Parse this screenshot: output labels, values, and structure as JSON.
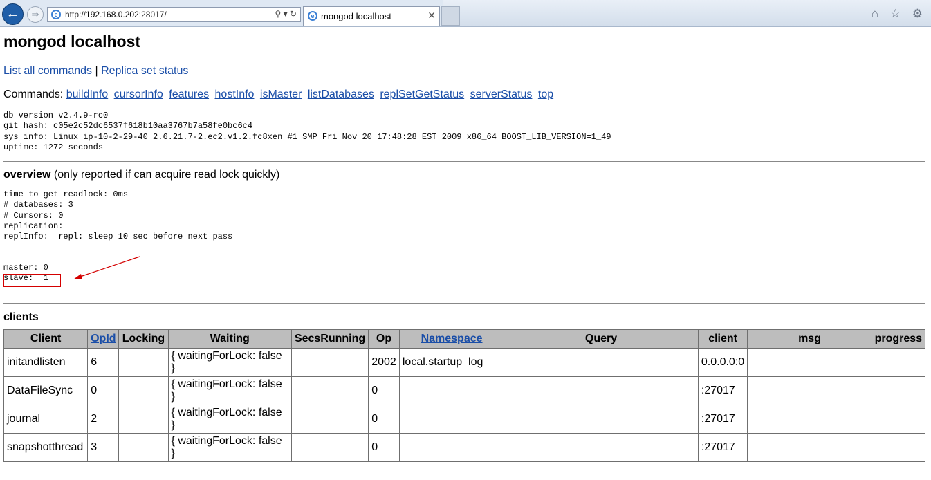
{
  "browser": {
    "url_prefix": "http://",
    "url_host": "192.168.0.202",
    "url_rest": ":28017/",
    "tab_title": "mongod localhost",
    "tools": "⚲ ▾ ↻",
    "close": "✕",
    "right_icons": "⌂ ☆ ⚙"
  },
  "page": {
    "title": "mongod localhost",
    "links": {
      "list_commands": "List all commands",
      "sep": " | ",
      "replica_status": "Replica set status"
    },
    "commands_label": "Commands: ",
    "commands": [
      "buildInfo",
      "cursorInfo",
      "features",
      "hostInfo",
      "isMaster",
      "listDatabases",
      "replSetGetStatus",
      "serverStatus",
      "top"
    ],
    "version_info": "db version v2.4.9-rc0\ngit hash: c05e2c52dc6537f618b10aa3767b7a58fe0bc6c4\nsys info: Linux ip-10-2-29-40 2.6.21.7-2.ec2.v1.2.fc8xen #1 SMP Fri Nov 20 17:48:28 EST 2009 x86_64 BOOST_LIB_VERSION=1_49\nuptime: 1272 seconds",
    "overview_title": "overview",
    "overview_note": " (only reported if can acquire read lock quickly)",
    "overview_info": "time to get readlock: 0ms\n# databases: 3\n# Cursors: 0\nreplication:\nreplInfo:  repl: sleep 10 sec before next pass",
    "master_slave": "master: 0\nslave:  1",
    "clients_title": "clients"
  },
  "clients_table": {
    "headers": [
      "Client",
      "OpId",
      "Locking",
      "Waiting",
      "SecsRunning",
      "Op",
      "Namespace",
      "Query",
      "client",
      "msg",
      "progress"
    ],
    "rows": [
      [
        "initandlisten",
        "6",
        "",
        "{ waitingForLock: false }",
        "",
        "2002",
        "local.startup_log",
        "",
        "0.0.0.0:0",
        "",
        ""
      ],
      [
        "DataFileSync",
        "0",
        "",
        "{ waitingForLock: false }",
        "",
        "0",
        "",
        "",
        ":27017",
        "",
        ""
      ],
      [
        "journal",
        "2",
        "",
        "{ waitingForLock: false }",
        "",
        "0",
        "",
        "",
        ":27017",
        "",
        ""
      ],
      [
        "snapshotthread",
        "3",
        "",
        "{ waitingForLock: false }",
        "",
        "0",
        "",
        "",
        ":27017",
        "",
        ""
      ]
    ]
  },
  "colors": {
    "link": "#1a4ea8",
    "header_bg": "#bdbdbd",
    "annotation": "#d40000"
  }
}
